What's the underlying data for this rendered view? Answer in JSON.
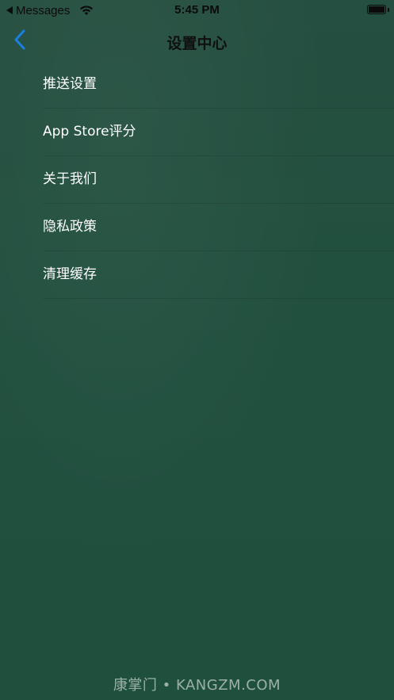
{
  "status_bar": {
    "back_app_label": "Messages",
    "time": "5:45 PM",
    "icons": [
      "back-arrow-icon",
      "wifi-icon",
      "battery-icon"
    ]
  },
  "nav": {
    "title": "设置中心",
    "back_icon": "chevron-left-icon",
    "accent_color": "#1a7fe0"
  },
  "settings": {
    "items": [
      {
        "label": "推送设置"
      },
      {
        "label": "App Store评分"
      },
      {
        "label": "关于我们"
      },
      {
        "label": "隐私政策"
      },
      {
        "label": "清理缓存"
      }
    ]
  },
  "watermark": {
    "text": "康掌门 • KANGZM.COM"
  },
  "colors": {
    "background": "#235241",
    "status_text": "#0b0b0b",
    "item_text": "#ffffff"
  }
}
